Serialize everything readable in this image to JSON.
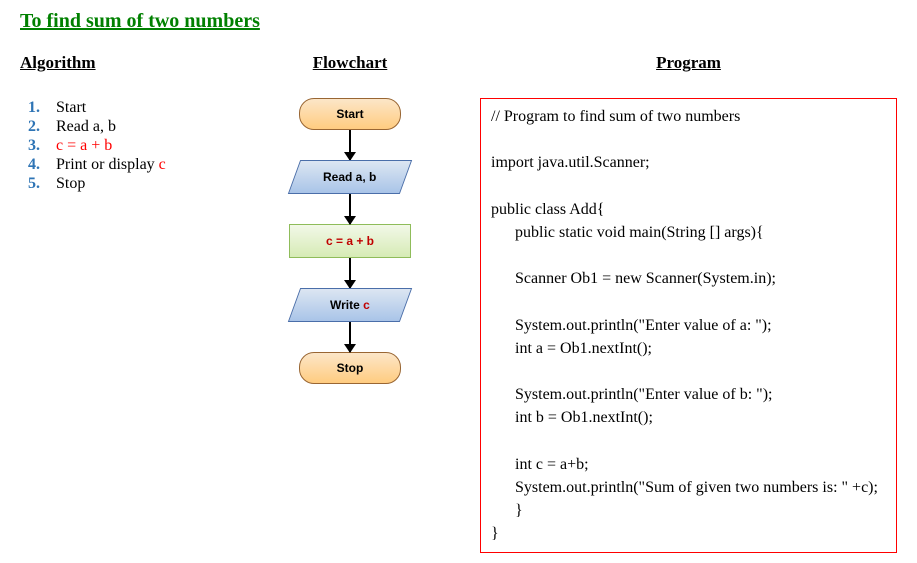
{
  "title": "To find sum of two numbers",
  "headings": {
    "algorithm": "Algorithm",
    "flowchart": "Flowchart",
    "program": "Program"
  },
  "algorithm": [
    {
      "num": "1.",
      "numColor": "blue",
      "text": "Start",
      "textColor": "black"
    },
    {
      "num": "2.",
      "numColor": "blue",
      "text": "Read a, b",
      "textColor": "black"
    },
    {
      "num": "3.",
      "numColor": "blue",
      "text": "c = a + b",
      "textColor": "red"
    },
    {
      "num": "4.",
      "numColor": "blue",
      "text": "Print or display ",
      "textColor": "black",
      "extra": "c",
      "extraColor": "red"
    },
    {
      "num": "5.",
      "numColor": "blue",
      "text": "Stop",
      "textColor": "black"
    }
  ],
  "flowchart": {
    "start": "Start",
    "read": "Read a, b",
    "process": "c = a + b",
    "writePrefix": "Write ",
    "writeVar": "c",
    "stop": "Stop"
  },
  "program": "// Program to find sum of two numbers\n\nimport java.util.Scanner;\n\npublic class Add{\n      public static void main(String [] args){\n\n      Scanner Ob1 = new Scanner(System.in);\n\n      System.out.println(\"Enter value of a: \");\n      int a = Ob1.nextInt();\n\n      System.out.println(\"Enter value of b: \");\n      int b = Ob1.nextInt();\n\n      int c = a+b;\n      System.out.println(\"Sum of given two numbers is: \" +c);\n      }\n}"
}
